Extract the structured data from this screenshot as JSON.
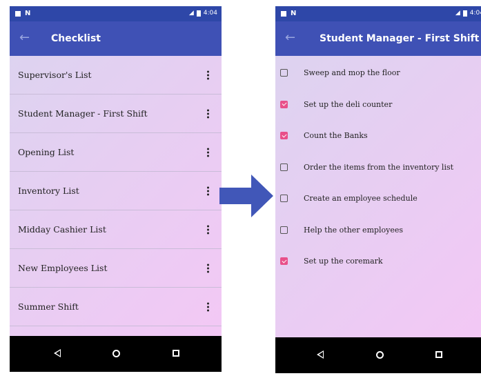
{
  "status_bar": {
    "time": "4:04"
  },
  "left_screen": {
    "title": "Checklist",
    "lists": [
      {
        "label": "Supervisor's List"
      },
      {
        "label": "Student Manager - First Shift"
      },
      {
        "label": "Opening List"
      },
      {
        "label": "Inventory List"
      },
      {
        "label": "Midday Cashier List"
      },
      {
        "label": "New Employees List"
      },
      {
        "label": "Summer Shift"
      }
    ]
  },
  "right_screen": {
    "title": "Student Manager - First Shift",
    "tasks": [
      {
        "label": "Sweep and mop the floor",
        "checked": false
      },
      {
        "label": "Set up the deli counter",
        "checked": true
      },
      {
        "label": "Count the Banks",
        "checked": true
      },
      {
        "label": "Order the items from the inventory list",
        "checked": false
      },
      {
        "label": "Create an employee schedule",
        "checked": false
      },
      {
        "label": "Help the other employees",
        "checked": false
      },
      {
        "label": "Set up the coremark",
        "checked": true
      }
    ]
  },
  "icons": {
    "back": "arrow-left-icon",
    "overflow": "more-vert-icon",
    "arrow": "arrow-right-icon",
    "nav_back": "nav-back-icon",
    "nav_home": "nav-home-icon",
    "nav_recent": "nav-recent-icon"
  },
  "colors": {
    "statusbar": "#2e47a8",
    "appbar": "#3f51b5",
    "checkbox_checked": "#e8508a",
    "arrow": "#4157b8",
    "background_start": "#ddd3f0",
    "background_end": "#f3c8f5"
  }
}
